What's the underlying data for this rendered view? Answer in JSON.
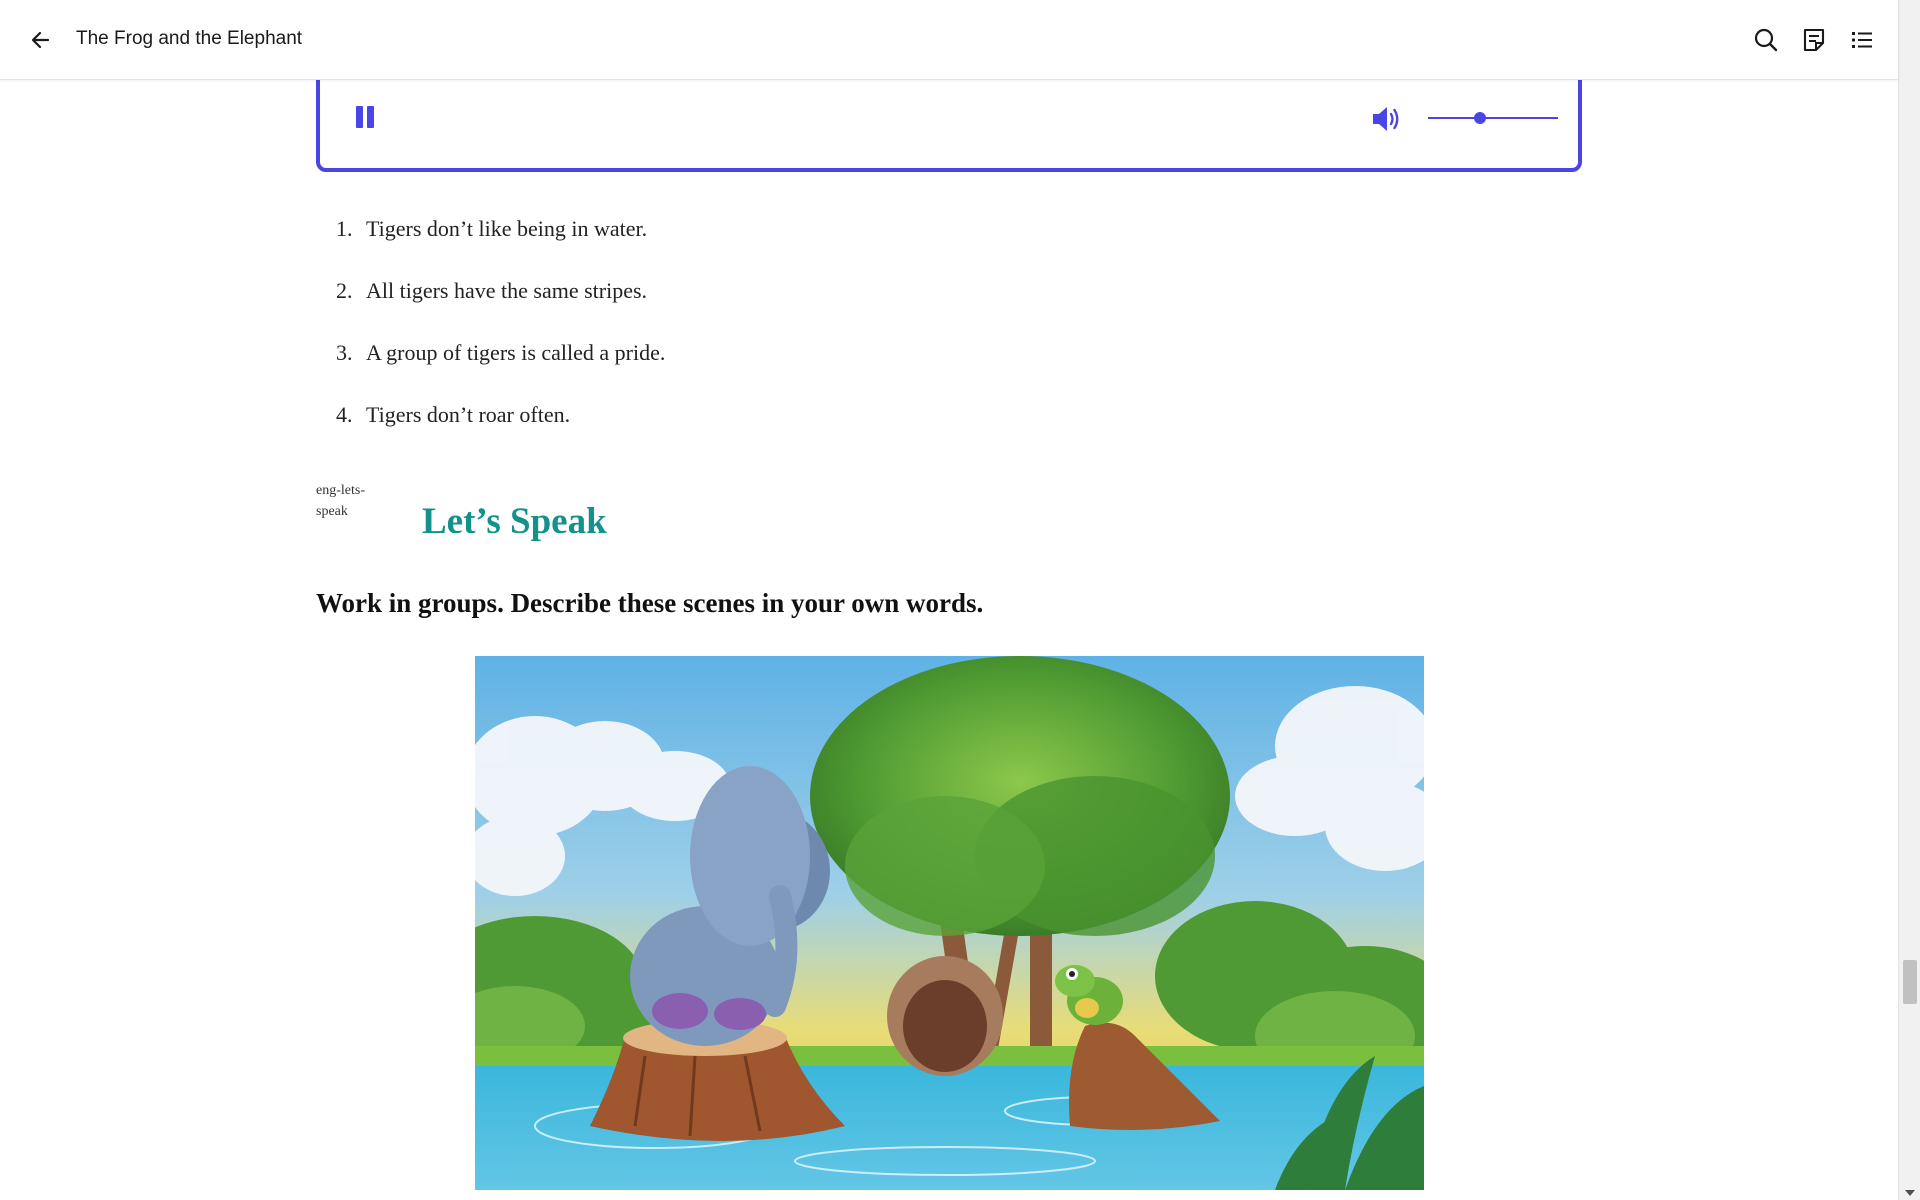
{
  "header": {
    "title": "The Frog and the Elephant",
    "icons": [
      "back-arrow-icon",
      "search-icon",
      "notes-icon",
      "toc-list-icon"
    ]
  },
  "audio_player": {
    "state": "playing",
    "volume_level": 0.4,
    "accent_color": "#4a45e5"
  },
  "facts": [
    {
      "num": "1.",
      "text": "Tigers don’t like being in water."
    },
    {
      "num": "2.",
      "text": "All tigers have the same stripes."
    },
    {
      "num": "3.",
      "text": "A group of tigers is called a pride."
    },
    {
      "num": "4.",
      "text": "Tigers don’t roar often."
    }
  ],
  "section": {
    "image_alt": "eng-lets-speak",
    "heading": "Let’s Speak",
    "heading_color": "#13918b",
    "instruction": "Work in groups. Describe these scenes in your own words."
  },
  "scene": {
    "subject": "illustration: sad elephant on a tree stump and a frog on a rock in a pond"
  }
}
